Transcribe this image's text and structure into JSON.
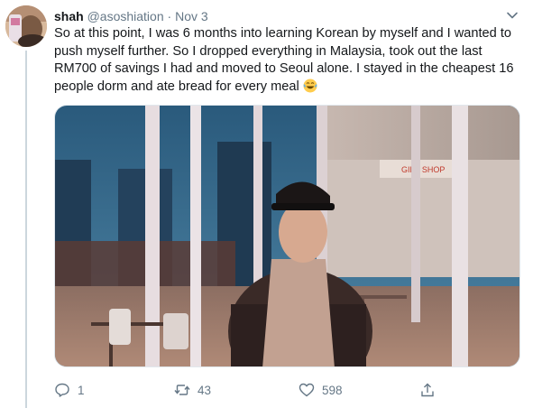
{
  "tweet": {
    "author_name": "shah",
    "author_handle": "@asoshiation",
    "separator": "·",
    "date": "Nov 3",
    "text": "So at this point, I was 6 months into learning Korean by myself and I wanted to push myself further. So I dropped everything in Malaysia, took out the last RM700 of savings I had and moved to Seoul alone. I stayed in the cheapest 16 people dorm and ate bread for every meal",
    "emoji": "face-with-tears-of-joy",
    "media": {
      "description_icon": "photo",
      "sign_text": "GIFT SHOP"
    }
  },
  "actions": {
    "reply_count": "1",
    "retweet_count": "43",
    "like_count": "598"
  },
  "colors": {
    "text_primary": "#14171a",
    "text_secondary": "#657786",
    "thread_line": "#ccd6dd"
  }
}
